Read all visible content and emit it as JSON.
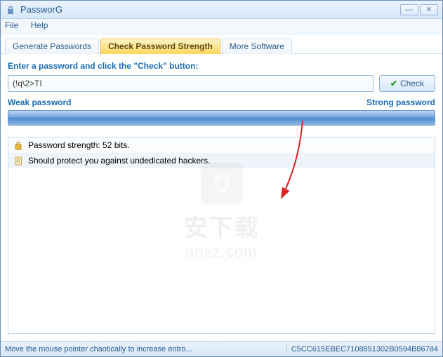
{
  "window": {
    "title": "PassworG"
  },
  "menu": {
    "file": "File",
    "help": "Help"
  },
  "tabs": {
    "generate": "Generate Passwords",
    "check": "Check Password Strength",
    "more": "More Software"
  },
  "main": {
    "prompt": "Enter a password and click the \"Check\" button:",
    "password_value": "(!q\\2>TI",
    "check_label": "Check",
    "weak_label": "Weak password",
    "strong_label": "Strong password",
    "result1": "Password strength: 52 bits.",
    "result2": "Should protect you against undedicated hackers."
  },
  "statusbar": {
    "hint": "Move the mouse pointer chaotically to increase entro...",
    "hash": "C5CC615EBEC7108851302B0594B86784"
  },
  "watermark": {
    "line1": "安下载",
    "line2": "anxz.com"
  }
}
